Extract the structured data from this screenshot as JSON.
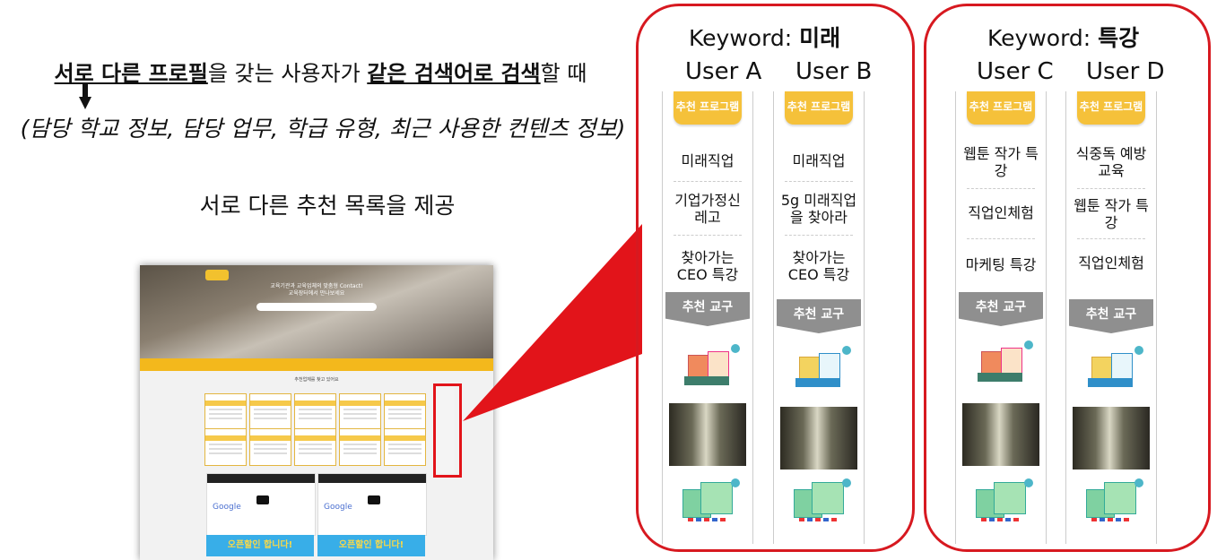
{
  "left": {
    "headline": {
      "part1": "서로 다른 프로필",
      "part2": "을 갖는 사용자가 ",
      "part3": "같은 검색어로 검색",
      "part4": "할 때"
    },
    "profile_note": "(담당 학교 정보, 담당 업무, 학급 유형, 최근 사용한 컨텐츠 정보)",
    "result_note": "서로 다른 추천 목록을 제공"
  },
  "site": {
    "hero_title": "교육기관과 교육업체의 맞춤형 Contact!",
    "hero_subtitle": "교육장터에서 만나보세요",
    "section_title": "추천업체를 찾고 있어요",
    "video_brand": "Google",
    "banner_text": "오픈할인 합니다!"
  },
  "groups": [
    {
      "keyword_label": "Keyword: ",
      "keyword": "미래",
      "program_label": "추천 프로그램",
      "tools_label": "추천 교구",
      "users": [
        {
          "name": "User A",
          "programs": [
            "미래직업",
            "기업가정신 레고",
            "찾아가는 CEO 특강"
          ]
        },
        {
          "name": "User B",
          "programs": [
            "미래직업",
            "5g 미래직업 을 찾아라",
            "찾아가는 CEO 특강"
          ]
        }
      ]
    },
    {
      "keyword_label": "Keyword: ",
      "keyword": "특강",
      "program_label": "추천 프로그램",
      "tools_label": "추천 교구",
      "users": [
        {
          "name": "User C",
          "programs": [
            "웹툰 작가 특 강",
            "직업인체험",
            "마케팅 특강"
          ]
        },
        {
          "name": "User D",
          "programs": [
            "식중독 예방 교육",
            "웹툰 작가 특 강",
            "직업인체험"
          ]
        }
      ]
    }
  ],
  "colors": {
    "highlight": "#d71920",
    "ribbon": "#f5c13a",
    "tools_tab": "#8f8f8f"
  }
}
